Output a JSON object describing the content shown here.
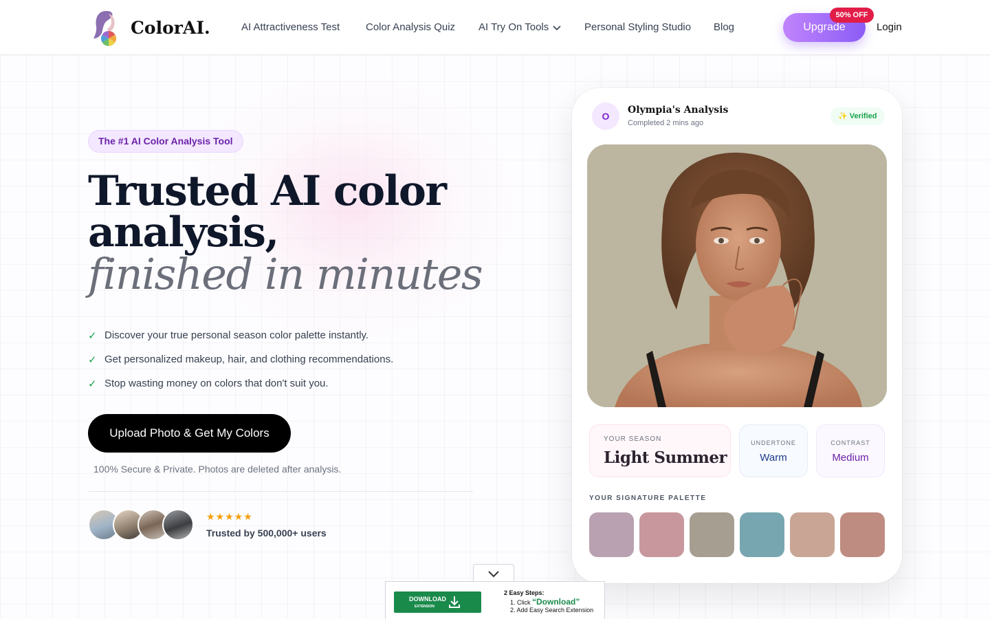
{
  "brand": {
    "name": "ColorAI."
  },
  "nav": {
    "links": [
      "AI Attractiveness Test",
      "Color Analysis Quiz",
      "AI Try On Tools",
      "Personal Styling Studio",
      "Blog"
    ],
    "upgrade_label": "Upgrade",
    "discount_badge": "50% OFF",
    "login_label": "Login"
  },
  "hero": {
    "pill": "The #1 AI Color Analysis Tool",
    "headline_line1": "Trusted AI color",
    "headline_line2": "analysis,",
    "headline_italic": "finished in minutes",
    "bullets": [
      "Discover your true personal season color palette instantly.",
      "Get personalized makeup, hair, and clothing recommendations.",
      "Stop wasting money on colors that don't suit you."
    ],
    "cta_label": "Upload Photo & Get My Colors",
    "secure_note": "100% Secure & Private. Photos are deleted after analysis.",
    "stars": "★★★★★",
    "trusted_text": "Trusted by 500,000+ users"
  },
  "card": {
    "avatar_initial": "O",
    "title": "Olympia's Analysis",
    "time": "Completed 2 mins ago",
    "verified": "✨ Verified",
    "season_label": "YOUR SEASON",
    "season_value": "Light Summer",
    "undertone_label": "UNDERTONE",
    "undertone_value": "Warm",
    "contrast_label": "CONTRAST",
    "contrast_value": "Medium",
    "palette_label": "YOUR SIGNATURE PALETTE",
    "palette_colors": [
      "#b9a1b1",
      "#c8979e",
      "#a69e91",
      "#77a6b1",
      "#c8a595",
      "#bf8c81"
    ]
  },
  "extension": {
    "button_main": "DOWNLOAD",
    "button_sub": "EXTENSION",
    "steps_title": "2 Easy Steps:",
    "step1_prefix": "1. Click ",
    "step1_highlight": "“Download”",
    "step2": "2. Add Easy Search Extension"
  },
  "colors": {
    "accent": "#8b5cf6",
    "badge": "#e11d48",
    "check": "#16a34a",
    "extension_green": "#1a8a4b"
  }
}
